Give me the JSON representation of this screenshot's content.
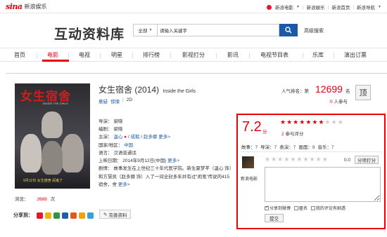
{
  "topbar": {
    "logo_sina": "sina",
    "logo_sub": "新浪娱乐",
    "links": [
      "新浪电影",
      "新浪娱乐",
      "新浪首页",
      "新浪导航"
    ]
  },
  "header": {
    "brand": "互动资料库",
    "search_select": "全部",
    "search_value": "请输入关键字",
    "advanced": "高级搜索"
  },
  "nav": {
    "items": [
      "首页",
      "电影",
      "电视",
      "明星",
      "排行榜",
      "影视打分",
      "影讯",
      "电视节目表",
      "乐库",
      "演出订票"
    ],
    "active": "电影"
  },
  "movie": {
    "title": "女生宿舍 (2014)",
    "title_en": "Inside the Girls",
    "genres": [
      "悬疑",
      "惊悚"
    ],
    "format": "2D",
    "rank_label": "人气排名：第",
    "rank_num": "12699",
    "rank_unit": "名",
    "voters_num": "0",
    "voters_label": "人参与",
    "ding": "顶",
    "info": {
      "director_k": "导演：",
      "director_v": "梁晓",
      "writer_k": "编剧：",
      "writer_v": "梁晓",
      "cast_k": "主演：",
      "cast_v1": "温心",
      "cast_v2": "成毅",
      "cast_v3": "赵多娜",
      "cast_more": "更多>",
      "region_k": "国家/地区：",
      "region_v": "中国",
      "lang_k": "语言：",
      "lang_v": "汉语普通话",
      "release_k": "上映日期：",
      "release_v": "2014年9月12日(中国)",
      "release_more": "更多>",
      "plot_k": "剧情：",
      "plot_v": "故事发生在上世纪三十年代医学院。新生夏梦芊（温心 饰）和方慧凯（赵多娜 饰）入了一间全封多年并有过“闹鬼”传说的415宿舍，舍",
      "plot_more": "更多>"
    },
    "poster": {
      "title": "女生宿舍",
      "sub": "INSIDE THE GIRLS",
      "caption": "9月12日 女生宿舍 闹鬼了"
    },
    "views_label": "浏览：",
    "views_num": "2689",
    "views_unit": "次"
  },
  "share": {
    "label": "分享到：",
    "icons": [
      "weibo-icon",
      "qzone-icon",
      "douban-icon",
      "renren-icon",
      "kaixin-icon",
      "mail-icon",
      "msn-icon"
    ],
    "edit_label": "完善资料"
  },
  "rating": {
    "score": "7.2",
    "score_unit": "分",
    "stars_on": 7,
    "stars_total": 10,
    "count_num": "2",
    "count_label": "参与评分",
    "subs": [
      {
        "k": "故事：",
        "v": "7"
      },
      {
        "k": "导演：",
        "v": "7"
      },
      {
        "k": "表演：",
        "v": "7"
      },
      {
        "k": "画面：",
        "v": "9"
      },
      {
        "k": "音乐：",
        "v": "7"
      }
    ],
    "user_name": "新浪电影",
    "my_score": "0.0",
    "split_button": "分项打分",
    "checks": [
      {
        "label": "分享到微博",
        "checked": true
      },
      {
        "label": "匿名",
        "checked": false
      },
      {
        "label": "我的评论有剧透",
        "checked": false
      }
    ],
    "submit": "提交"
  },
  "colors": {
    "accent_red": "#e50012",
    "link_blue": "#1a5aa8",
    "highlight_border": "#ee0000"
  }
}
